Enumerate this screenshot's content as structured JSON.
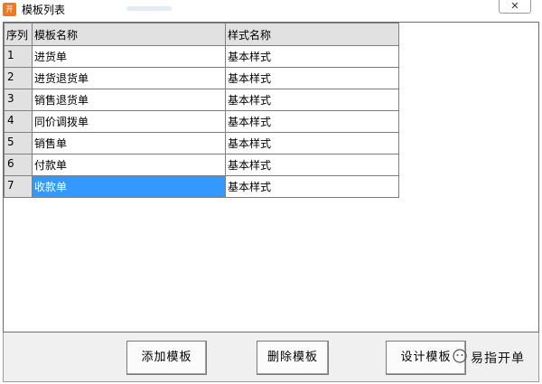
{
  "window": {
    "title": "模板列表",
    "close_label": "✕"
  },
  "grid": {
    "columns": [
      "序列",
      "模板名称",
      "样式名称"
    ],
    "rows": [
      {
        "index": "1",
        "template_name": "进货单",
        "style_name": "基本样式"
      },
      {
        "index": "2",
        "template_name": "进货退货单",
        "style_name": "基本样式"
      },
      {
        "index": "3",
        "template_name": "销售退货单",
        "style_name": "基本样式"
      },
      {
        "index": "4",
        "template_name": "同价调拨单",
        "style_name": "基本样式"
      },
      {
        "index": "5",
        "template_name": "销售单",
        "style_name": "基本样式"
      },
      {
        "index": "6",
        "template_name": "付款单",
        "style_name": "基本样式"
      },
      {
        "index": "7",
        "template_name": "收款单",
        "style_name": "基本样式"
      }
    ],
    "selected_row": 7,
    "selection_color": "#3399ff"
  },
  "buttons": {
    "add_label": "添加模板",
    "delete_label": "删除模板",
    "design_label": "设计模板"
  },
  "watermark": {
    "text": "易指开单"
  },
  "colors": {
    "app_icon": "#ef7a25",
    "header_bg": "#e1e1e1",
    "bottom_bar_bg": "#f0f0f0"
  }
}
